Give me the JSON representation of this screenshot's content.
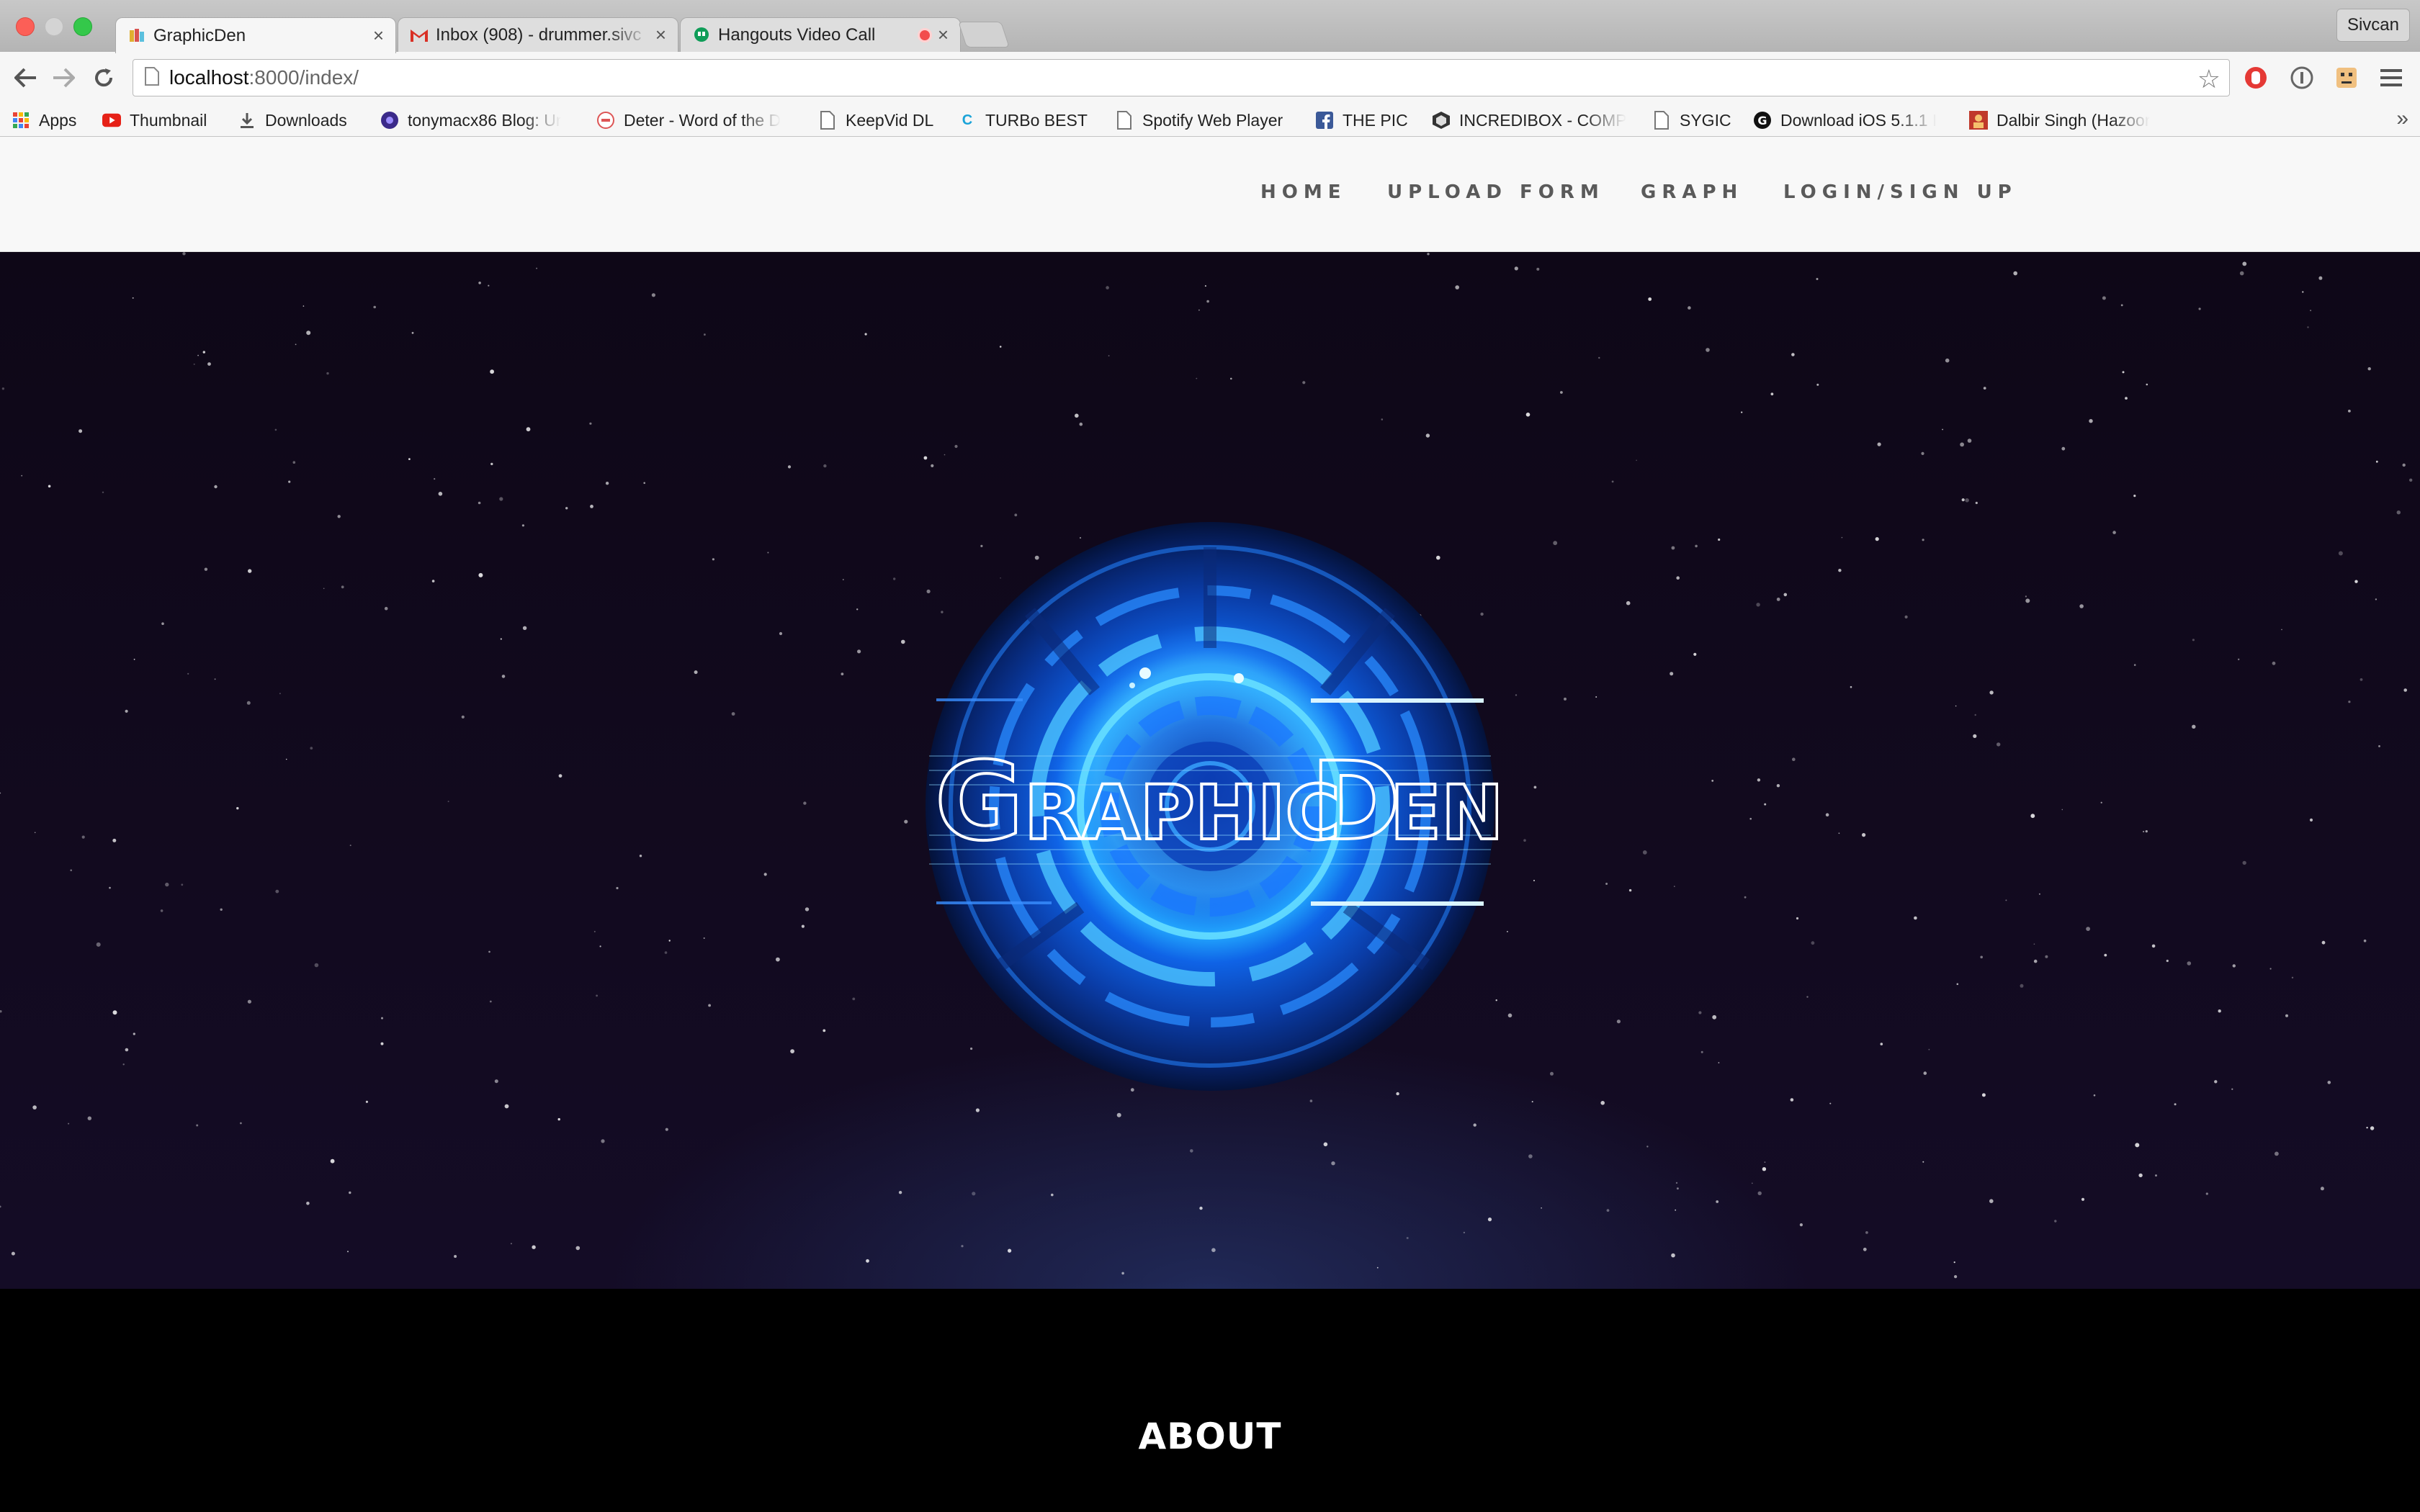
{
  "browser": {
    "tabs": [
      {
        "title": "GraphicDen",
        "active": true,
        "favicon": "graphicden-favicon"
      },
      {
        "title": "Inbox (908) - drummer.sivc",
        "active": false,
        "favicon": "gmail-icon"
      },
      {
        "title": "Hangouts Video Call",
        "active": false,
        "favicon": "hangouts-icon",
        "recording": true
      }
    ],
    "profile_name": "Sivcan",
    "url_host": "localhost",
    "url_rest": ":8000/index/",
    "bookmarks": [
      {
        "label": "Apps",
        "icon": "apps-grid-icon"
      },
      {
        "label": "Thumbnail",
        "icon": "youtube-icon"
      },
      {
        "label": "Downloads",
        "icon": "download-icon"
      },
      {
        "label": "tonymacx86 Blog: Ur",
        "icon": "tonymac-icon"
      },
      {
        "label": "Deter - Word of the D",
        "icon": "word-icon"
      },
      {
        "label": "KeepVid DL",
        "icon": "page-icon"
      },
      {
        "label": "TURBo BEST",
        "icon": "c-icon"
      },
      {
        "label": "Spotify Web Player",
        "icon": "page-icon"
      },
      {
        "label": "THE PIC",
        "icon": "facebook-icon"
      },
      {
        "label": "INCREDIBOX - COMP",
        "icon": "box-icon"
      },
      {
        "label": "SYGIC",
        "icon": "page-icon"
      },
      {
        "label": "Download iOS 5.1.1 I",
        "icon": "g-icon"
      },
      {
        "label": "Dalbir Singh (Hazoor",
        "icon": "portrait-icon"
      }
    ]
  },
  "site": {
    "nav": [
      {
        "label": "HOME"
      },
      {
        "label": "UPLOAD FORM"
      },
      {
        "label": "GRAPH"
      },
      {
        "label": "LOGIN/SIGN UP"
      }
    ],
    "logo_text_1": "G",
    "logo_text_2": "RAPHIC",
    "logo_text_3": "D",
    "logo_text_4": "EN",
    "about_title": "ABOUT"
  },
  "colors": {
    "logo_blue": "#1e8bff",
    "logo_cyan": "#7fe6ff",
    "nav_text": "#5a5a5a"
  }
}
